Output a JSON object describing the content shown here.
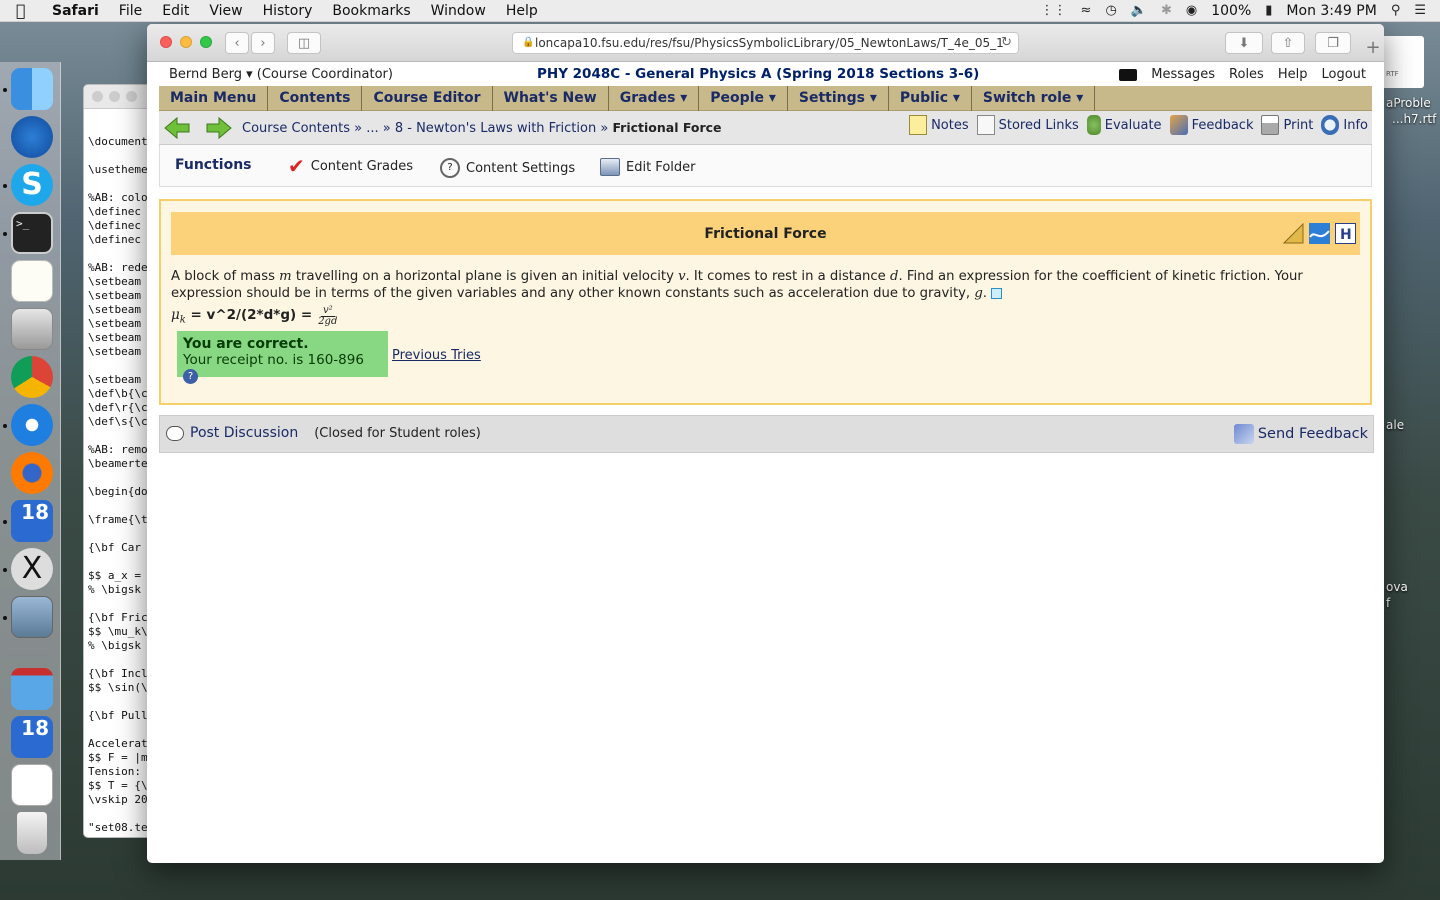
{
  "mac_menubar": {
    "app_name": "Safari",
    "menus": [
      "File",
      "Edit",
      "View",
      "History",
      "Bookmarks",
      "Window",
      "Help"
    ],
    "battery": "100%",
    "clock": "Mon 3:49 PM"
  },
  "dock": {
    "badge_count": "18"
  },
  "bg_window": {
    "code_lines": [
      "\\document",
      "",
      "\\usetheme",
      "",
      "%AB: colo",
      "\\definec",
      "\\definec",
      "\\definec",
      "",
      "%AB: rede",
      "\\setbeam",
      "\\setbeam",
      "\\setbeam",
      "\\setbeam",
      "\\setbeam",
      "\\setbeam",
      "",
      "\\setbeam",
      "\\def\\b{\\c",
      "\\def\\r{\\c",
      "\\def\\s{\\c",
      "",
      "%AB: remo",
      "\\beamerte",
      "",
      "\\begin{do",
      "",
      "\\frame{\\t",
      "",
      "{\\bf Car",
      "",
      "$$ a_x =",
      "% \\bigsk",
      "",
      "{\\bf Fric",
      "$$ \\mu_k\\",
      "% \\bigsk",
      "",
      "{\\bf Incl",
      "$$ \\sin(\\",
      "",
      "{\\bf Pull",
      "",
      "Accelerat",
      "$$ F = |m",
      "Tension:",
      "$$ T = {\\",
      "\\vskip 20",
      "",
      "\"set08.te"
    ]
  },
  "desktop_files": {
    "rtf_label": "RTF",
    "file1_name_a": "aProble",
    "file1_name_b": "...h7.rtf",
    "file2_name": "ale",
    "file3_name_a": "ova",
    "file3_name_b": "f"
  },
  "browser": {
    "url": "loncapa10.fsu.edu/res/fsu/PhysicsSymbolicLibrary/05_NewtonLaws/T_4e_05_1"
  },
  "userbar": {
    "user": "Bernd Berg ▾",
    "role": "(Course Coordinator)",
    "course_title": "PHY 2048C - General Physics A (Spring 2018 Sections 3-6)",
    "messages": "Messages",
    "roles": "Roles",
    "help": "Help",
    "logout": "Logout"
  },
  "main_menu": [
    {
      "label": "Main Menu"
    },
    {
      "label": "Contents"
    },
    {
      "label": "Course Editor"
    },
    {
      "label": "What's New"
    },
    {
      "label": "Grades ▾"
    },
    {
      "label": "People ▾"
    },
    {
      "label": "Settings ▾"
    },
    {
      "label": "Public ▾"
    },
    {
      "label": "Switch role ▾"
    }
  ],
  "breadcrumb": {
    "course_contents": "Course Contents »",
    "ellipsis": "... »",
    "folder": "8 - Newton's Laws with Friction »",
    "current": "Frictional Force"
  },
  "tools": {
    "notes": "Notes",
    "stored_links": "Stored Links",
    "evaluate": "Evaluate",
    "feedback": "Feedback",
    "print": "Print",
    "info": "Info"
  },
  "functions": {
    "label": "Functions",
    "content_grades": "Content Grades",
    "content_settings": "Content Settings",
    "edit_folder": "Edit Folder"
  },
  "problem": {
    "title": "Frictional Force",
    "text_1": "A block of mass ",
    "var_m": "m",
    "text_2": " travelling on a horizontal plane is given an initial velocity ",
    "var_v": "v",
    "text_3": ". It comes to rest in a distance ",
    "var_d": "d",
    "text_4": ". Find an expression for the coefficient of kinetic friction. Your expression should be in terms of the given variables and any other known constants such as acceleration due to gravity, ",
    "var_g": "g",
    "text_5": ".",
    "answer_symbol": "μ",
    "answer_sub": "k",
    "answer_text": " = v^2/(2*d*g) =",
    "frac_num": "v²",
    "frac_den": "2gd",
    "correct_title": "You are correct.",
    "receipt": "Your receipt no. is 160-896",
    "help_q": "?",
    "previous_tries": "Previous Tries"
  },
  "discussion": {
    "post": "Post Discussion",
    "closed": "(Closed for Student roles)",
    "send_feedback": "Send Feedback"
  }
}
